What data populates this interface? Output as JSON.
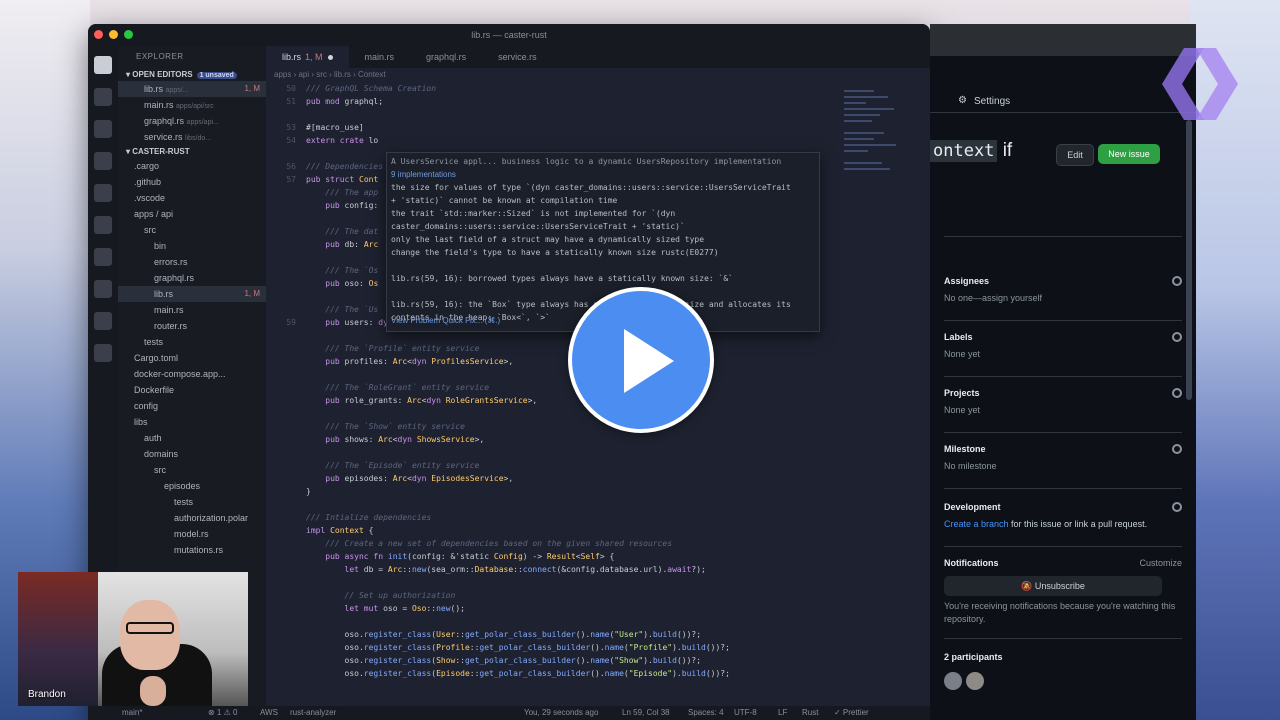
{
  "window_title": "lib.rs — caster-rust",
  "tabs": [
    {
      "label": "lib.rs",
      "badge": "1, M",
      "active": true
    },
    {
      "label": "main.rs",
      "active": false
    },
    {
      "label": "graphql.rs",
      "active": false
    },
    {
      "label": "service.rs",
      "active": false
    }
  ],
  "breadcrumb": "apps › api › src › lib.rs › Context",
  "explorer": {
    "header": "EXPLORER",
    "open_editors": "OPEN EDITORS",
    "unsaved": "1 unsaved",
    "open_files": [
      {
        "name": "lib.rs",
        "hint": "apps/...",
        "badge": "1, M"
      },
      {
        "name": "main.rs",
        "hint": "apps/api/src"
      },
      {
        "name": "graphql.rs",
        "hint": "apps/api..."
      },
      {
        "name": "service.rs",
        "hint": "libs/do..."
      }
    ],
    "root": "CASTER-RUST",
    "tree": [
      {
        "name": ".cargo",
        "indent": 1
      },
      {
        "name": ".github",
        "indent": 1
      },
      {
        "name": ".vscode",
        "indent": 1
      },
      {
        "name": "apps / api",
        "indent": 1
      },
      {
        "name": "src",
        "indent": 2
      },
      {
        "name": "bin",
        "indent": 3
      },
      {
        "name": "errors.rs",
        "indent": 3
      },
      {
        "name": "graphql.rs",
        "indent": 3
      },
      {
        "name": "lib.rs",
        "indent": 3,
        "badge": "1, M",
        "selected": true
      },
      {
        "name": "main.rs",
        "indent": 3
      },
      {
        "name": "router.rs",
        "indent": 3
      },
      {
        "name": "tests",
        "indent": 2
      },
      {
        "name": "Cargo.toml",
        "indent": 1
      },
      {
        "name": "docker-compose.app...",
        "indent": 1
      },
      {
        "name": "Dockerfile",
        "indent": 1
      },
      {
        "name": "config",
        "indent": 1
      },
      {
        "name": "libs",
        "indent": 1
      },
      {
        "name": "auth",
        "indent": 2
      },
      {
        "name": "domains",
        "indent": 2
      },
      {
        "name": "src",
        "indent": 3
      },
      {
        "name": "episodes",
        "indent": 4
      },
      {
        "name": "tests",
        "indent": 5
      },
      {
        "name": "authorization.polar",
        "indent": 5
      },
      {
        "name": "model.rs",
        "indent": 5
      },
      {
        "name": "mutations.rs",
        "indent": 5
      }
    ]
  },
  "hover": {
    "top": "A UsersService appl... business logic to a dynamic UsersRepository implementation",
    "impls": "9 implementations",
    "lines": [
      "the size for values of type `(dyn caster_domains::users::service::UsersServiceTrait",
      "+ 'static)` cannot be known at compilation time",
      "the trait `std::marker::Sized` is not implemented for `(dyn",
      "caster_domains::users::service::UsersServiceTrait + 'static)`",
      "only the last field of a struct may have a dynamically sized type",
      "change the field's type to have a statically known size rustc(E0277)",
      "",
      "lib.rs(59, 16): borrowed types always have a statically known size: `&`",
      "",
      "lib.rs(59, 16): the `Box` type always has a statically known size and allocates its",
      "contents in the heap: `Box<`, `>`"
    ],
    "footer": "View Problem   Quick Fix... (⌘.)"
  },
  "status": {
    "branch": "main*",
    "problems": "⊗ 1 ⚠ 0",
    "aws": "AWS",
    "analyzer": "rust-analyzer",
    "blame": "You, 29 seconds ago",
    "position": "Ln 59, Col 38",
    "spaces": "Spaces: 4",
    "encoding": "UTF-8",
    "eol": "LF",
    "lang": "Rust",
    "prettier": "✓ Prettier"
  },
  "github": {
    "settings_tab": "Settings",
    "title_code": "ontext",
    "title_rest": " if",
    "edit_btn": "Edit",
    "new_issue_btn": "New issue",
    "assignees_h": "Assignees",
    "assignees_v": "No one—assign yourself",
    "labels_h": "Labels",
    "labels_v": "None yet",
    "projects_h": "Projects",
    "projects_v": "None yet",
    "milestone_h": "Milestone",
    "milestone_v": "No milestone",
    "development_h": "Development",
    "development_link": "Create a branch",
    "development_rest": " for this issue or link a pull request.",
    "notifications_h": "Notifications",
    "customize": "Customize",
    "unsubscribe": "Unsubscribe",
    "notif_text": "You're receiving notifications because you're watching this repository.",
    "participants": "2 participants"
  },
  "webcam_name": "Brandon",
  "colors": {
    "accent_green": "#2ea043",
    "play_blue": "#4b8df0",
    "link_blue": "#4493f8"
  }
}
